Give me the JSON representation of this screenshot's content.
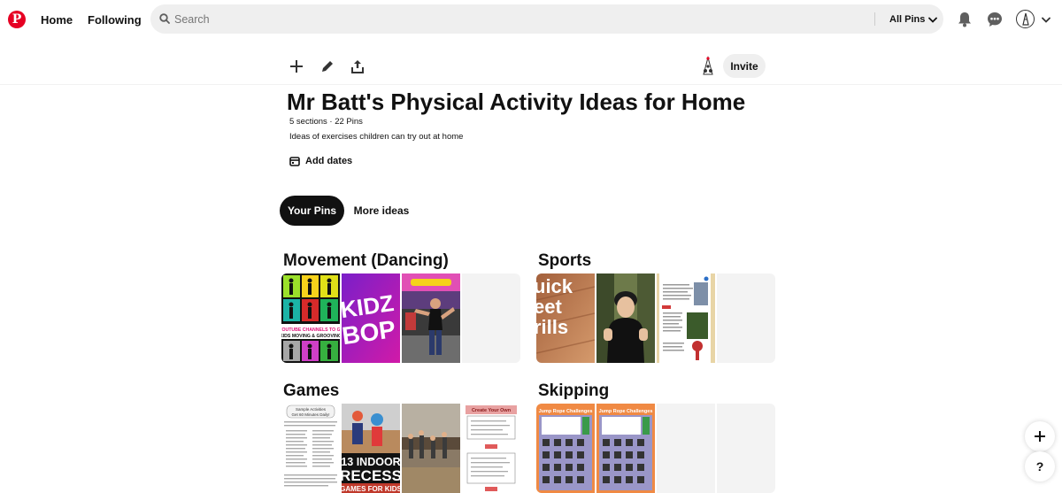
{
  "nav": {
    "home_label": "Home",
    "following_label": "Following",
    "search_placeholder": "Search",
    "filter_label": "All Pins",
    "icons": [
      "bell-icon",
      "messages-icon",
      "account-chevron-icon"
    ]
  },
  "toolbar": {
    "icons": [
      "plus-icon",
      "pencil-icon",
      "share-icon"
    ],
    "invite_label": "Invite"
  },
  "board": {
    "title": "Mr Batt's Physical Activity Ideas for Home",
    "meta": "5 sections · 22 Pins",
    "description": "Ideas of exercises children can try out at home",
    "add_dates_label": "Add dates"
  },
  "tabs": [
    {
      "label": "Your Pins",
      "active": true
    },
    {
      "label": "More ideas",
      "active": false
    }
  ],
  "sections": [
    {
      "title": "Movement (Dancing)",
      "thumbs": [
        {
          "kind": "silhouettes",
          "caption": "7 YOUTUBE CHANNELS TO GET KIDS MOVING & GROOVING"
        },
        {
          "kind": "kidzbop",
          "caption": "KIDZ BOP"
        },
        {
          "kind": "dance-photo",
          "caption": "GO NOODLE"
        },
        {
          "kind": "empty",
          "caption": ""
        }
      ]
    },
    {
      "title": "Sports",
      "thumbs": [
        {
          "kind": "drills",
          "caption": "uick eet rills"
        },
        {
          "kind": "person-photo",
          "caption": ""
        },
        {
          "kind": "document",
          "caption": ""
        },
        {
          "kind": "empty",
          "caption": ""
        }
      ]
    },
    {
      "title": "Games",
      "thumbs": [
        {
          "kind": "text-doc",
          "caption": "Sample Activities — Get 60 Minutes Daily!"
        },
        {
          "kind": "recess",
          "caption": "13 INDOOR RECESS GAMES FOR KIDS"
        },
        {
          "kind": "gym-photo",
          "caption": ""
        },
        {
          "kind": "create-dots",
          "caption": "Create Your Own"
        }
      ]
    },
    {
      "title": "Skipping",
      "thumbs": [
        {
          "kind": "jump-rope",
          "caption": "Jump Rope Challenges"
        },
        {
          "kind": "jump-rope",
          "caption": "Jump Rope Challenges"
        },
        {
          "kind": "empty",
          "caption": ""
        },
        {
          "kind": "empty",
          "caption": ""
        }
      ]
    }
  ],
  "floating": {
    "add_label": "+",
    "help_label": "?"
  },
  "colors": {
    "brand": "#e60023",
    "tab_active_bg": "#111111",
    "search_bg": "#efefef",
    "empty_thumb": "#f3f3f3"
  }
}
